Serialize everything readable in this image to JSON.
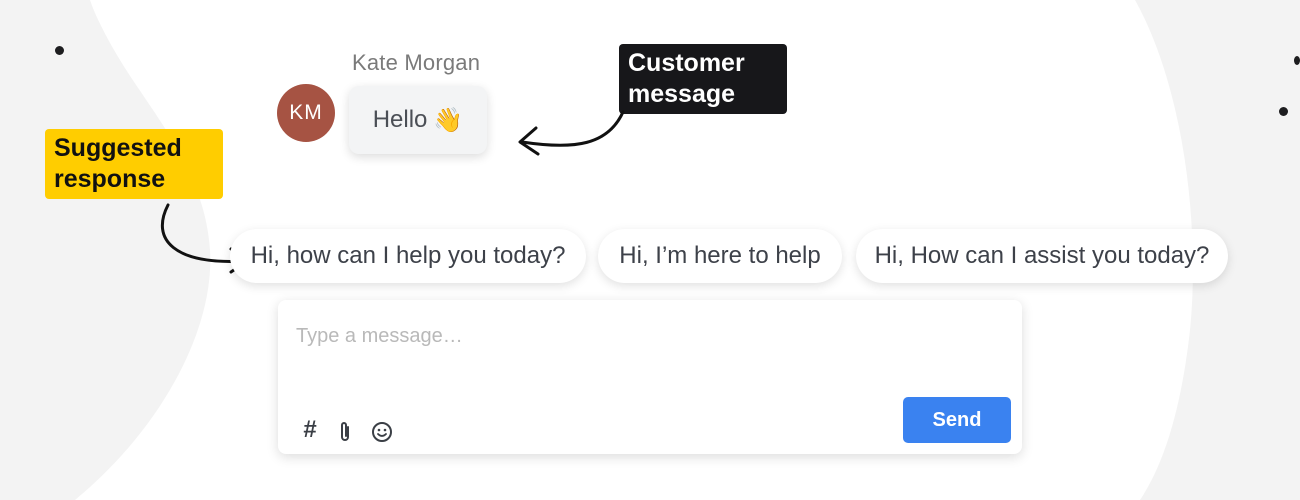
{
  "colors": {
    "background": "#f3f3f3",
    "blob": "#ffffff",
    "avatar": "#a65343",
    "callout_dark": "#17171a",
    "callout_yellow": "#ffcd00",
    "send_button": "#3a82f0"
  },
  "customer": {
    "name": "Kate Morgan",
    "initials": "KM",
    "message": "Hello",
    "message_emoji": "👋"
  },
  "annotations": {
    "customer_message": "Customer message",
    "suggested_response": "Suggested response"
  },
  "suggestions": [
    "Hi, how can I help you today?",
    "Hi, I’m here to help",
    "Hi, How can I assist you today?"
  ],
  "composer": {
    "placeholder": "Type a message…",
    "value": "",
    "tools": [
      "hashtag-icon",
      "paperclip-icon",
      "emoji-icon"
    ],
    "send_label": "Send"
  }
}
